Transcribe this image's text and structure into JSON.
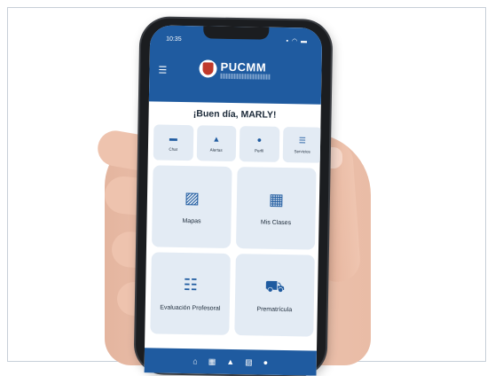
{
  "status": {
    "time": "10:35",
    "icons": "▪ ◠ ▬"
  },
  "header": {
    "logo_text": "PUCMM"
  },
  "greeting": "¡Buen día, MARLY!",
  "quick_actions": [
    {
      "label": "Chat",
      "icon": "chat-icon"
    },
    {
      "label": "Alertas",
      "icon": "bell-icon"
    },
    {
      "label": "Perfil",
      "icon": "person-icon"
    },
    {
      "label": "Servicios",
      "icon": "list-icon"
    }
  ],
  "tiles": [
    {
      "label": "Mapas",
      "icon": "map-icon"
    },
    {
      "label": "Mis Clases",
      "icon": "calendar-icon"
    },
    {
      "label": "Evaluación Profesoral",
      "icon": "form-list-icon"
    },
    {
      "label": "Prematrícula",
      "icon": "cart-icon"
    }
  ],
  "bottom_nav": [
    "home-icon",
    "calendar-icon",
    "bell-icon",
    "map-icon",
    "person-icon"
  ],
  "colors": {
    "primary": "#1f5ba0",
    "tile_bg": "#e3ebf4",
    "text_dark": "#1d2b3a"
  }
}
